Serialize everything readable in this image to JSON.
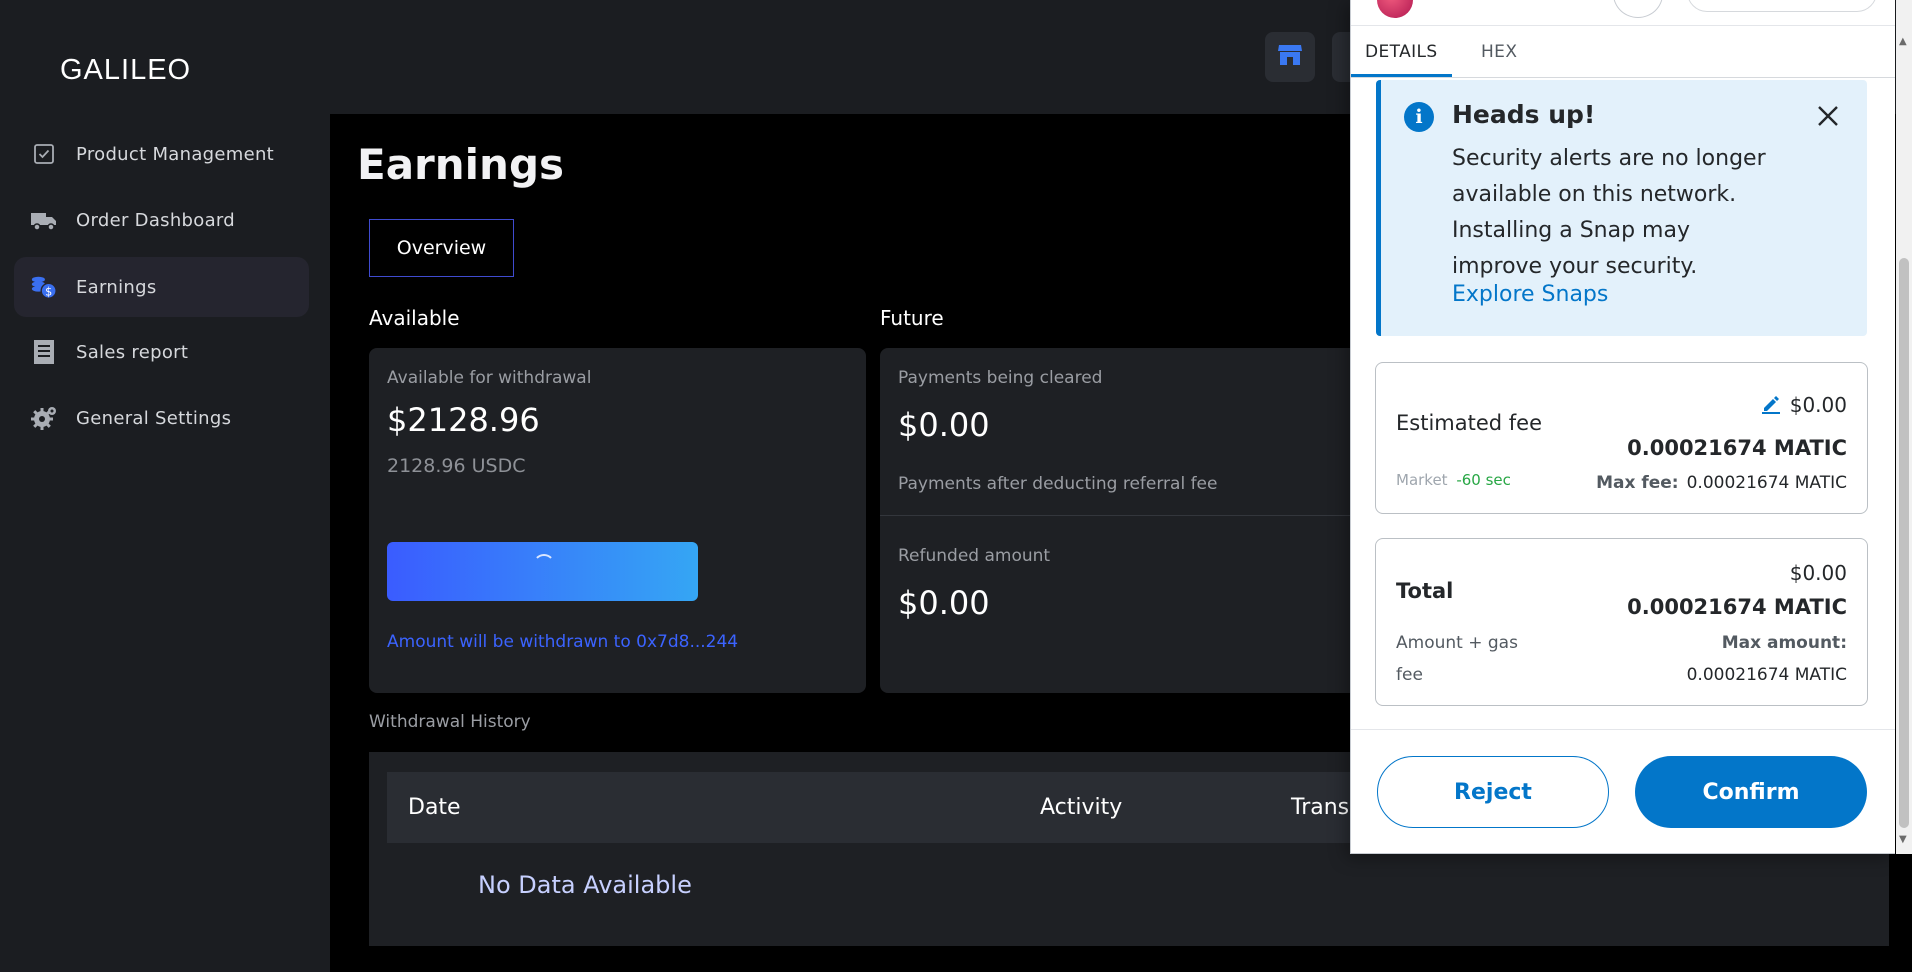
{
  "app": {
    "logo": "GALILEO"
  },
  "sidebar": {
    "items": [
      {
        "label": "Product Management",
        "icon": "checkbox-icon"
      },
      {
        "label": "Order Dashboard",
        "icon": "truck-icon"
      },
      {
        "label": "Earnings",
        "icon": "coins-icon",
        "active": true
      },
      {
        "label": "Sales report",
        "icon": "receipt-icon"
      },
      {
        "label": "General Settings",
        "icon": "gear-icon"
      }
    ]
  },
  "header": {
    "store_icon": "store-icon"
  },
  "page": {
    "title": "Earnings",
    "tab": "Overview",
    "available": {
      "section": "Available",
      "subtitle": "Available for withdrawal",
      "amount": "$2128.96",
      "usdc": "2128.96 USDC",
      "note": "Amount will be withdrawn to 0x7d8...244"
    },
    "future": {
      "section": "Future",
      "cleared_label": "Payments being cleared",
      "cleared_amount": "$0.00",
      "cleared_note": "Payments after deducting referral fee",
      "refunded_label": "Refunded amount",
      "refunded_amount": "$0.00"
    },
    "history": {
      "label": "Withdrawal History",
      "columns": [
        "Date",
        "Activity",
        "Trans"
      ],
      "empty": "No Data Available"
    }
  },
  "wallet": {
    "tabs": [
      "DETAILS",
      "HEX"
    ],
    "alert": {
      "title": "Heads up!",
      "body": "Security alerts are no longer available on this network. Installing a Snap may improve your security.",
      "link": "Explore Snaps"
    },
    "fee": {
      "label": "Estimated fee",
      "usd": "$0.00",
      "matic": "0.00021674 MATIC",
      "market": "Market",
      "time": "-60 sec",
      "max_label": "Max fee:",
      "max_value": "0.00021674 MATIC"
    },
    "total": {
      "label": "Total",
      "usd": "$0.00",
      "matic": "0.00021674 MATIC",
      "sub_label_1": "Amount + gas",
      "sub_label_2": "fee",
      "max_label": "Max amount:",
      "max_value": "0.00021674 MATIC"
    },
    "reject": "Reject",
    "confirm": "Confirm",
    "colors": {
      "primary": "#0376c9",
      "alert_bg": "#e3f1fb",
      "success": "#28a745"
    }
  }
}
